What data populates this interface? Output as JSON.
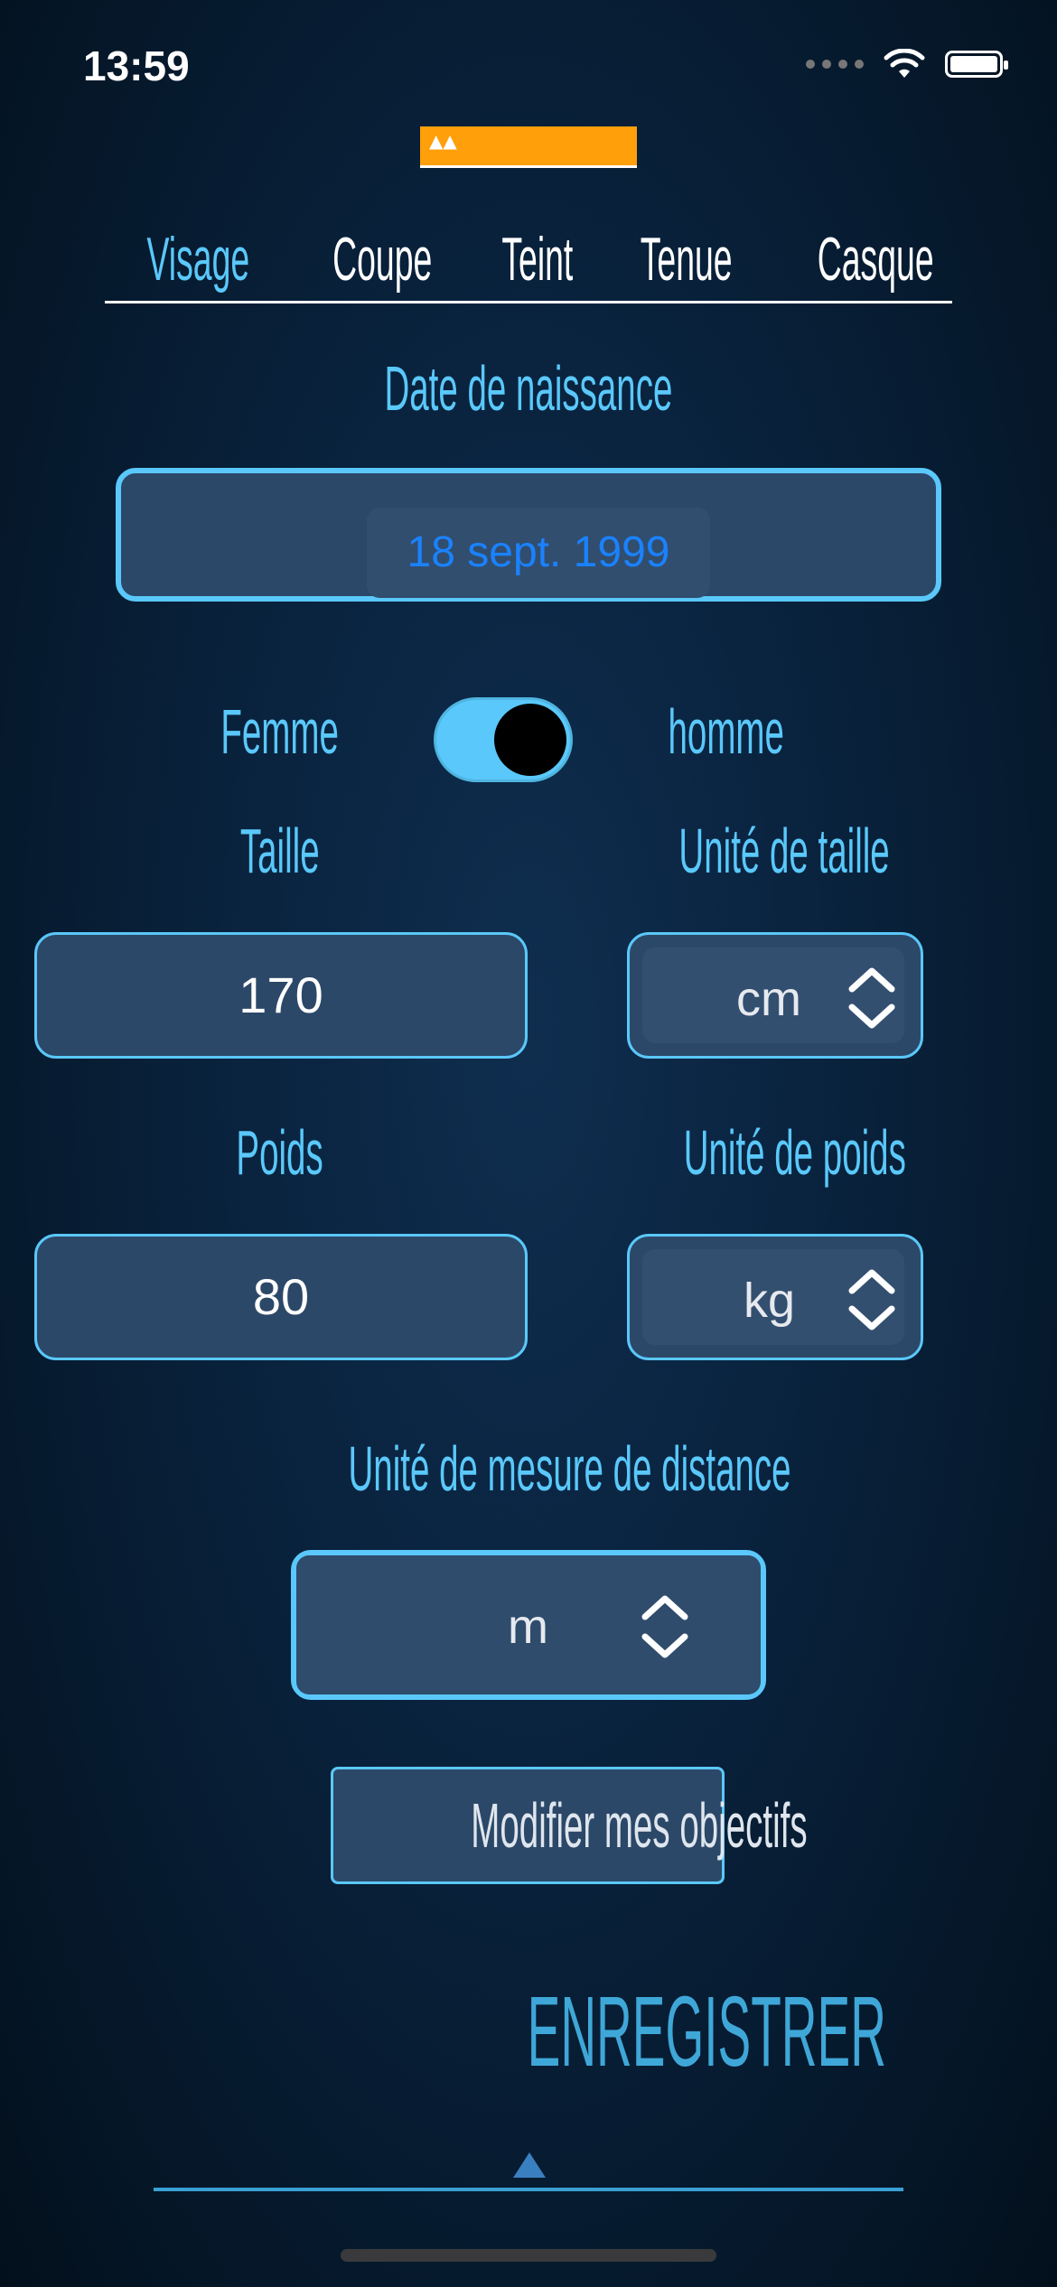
{
  "status": {
    "time": "13:59"
  },
  "tabs": [
    "Visage",
    "Coupe",
    "Teint",
    "Tenue",
    "Casque"
  ],
  "birth": {
    "label": "Date de naissance",
    "value": "18 sept. 1999"
  },
  "gender": {
    "left": "Femme",
    "right": "homme",
    "toggle_on": true
  },
  "height": {
    "label": "Taille",
    "value": "170",
    "unit_label": "Unité de taille",
    "unit": "cm"
  },
  "weight": {
    "label": "Poids",
    "value": "80",
    "unit_label": "Unité de poids",
    "unit": "kg"
  },
  "distance": {
    "label": "Unité de mesure de distance",
    "unit": "m"
  },
  "buttons": {
    "objectives": "Modifier mes objectifs",
    "save": "ENREGISTRER"
  },
  "colors": {
    "accent": "#5ac8fa",
    "logo": "#ff9f0a",
    "date_text": "#1a82ff",
    "field_bg": "#2c4868"
  }
}
